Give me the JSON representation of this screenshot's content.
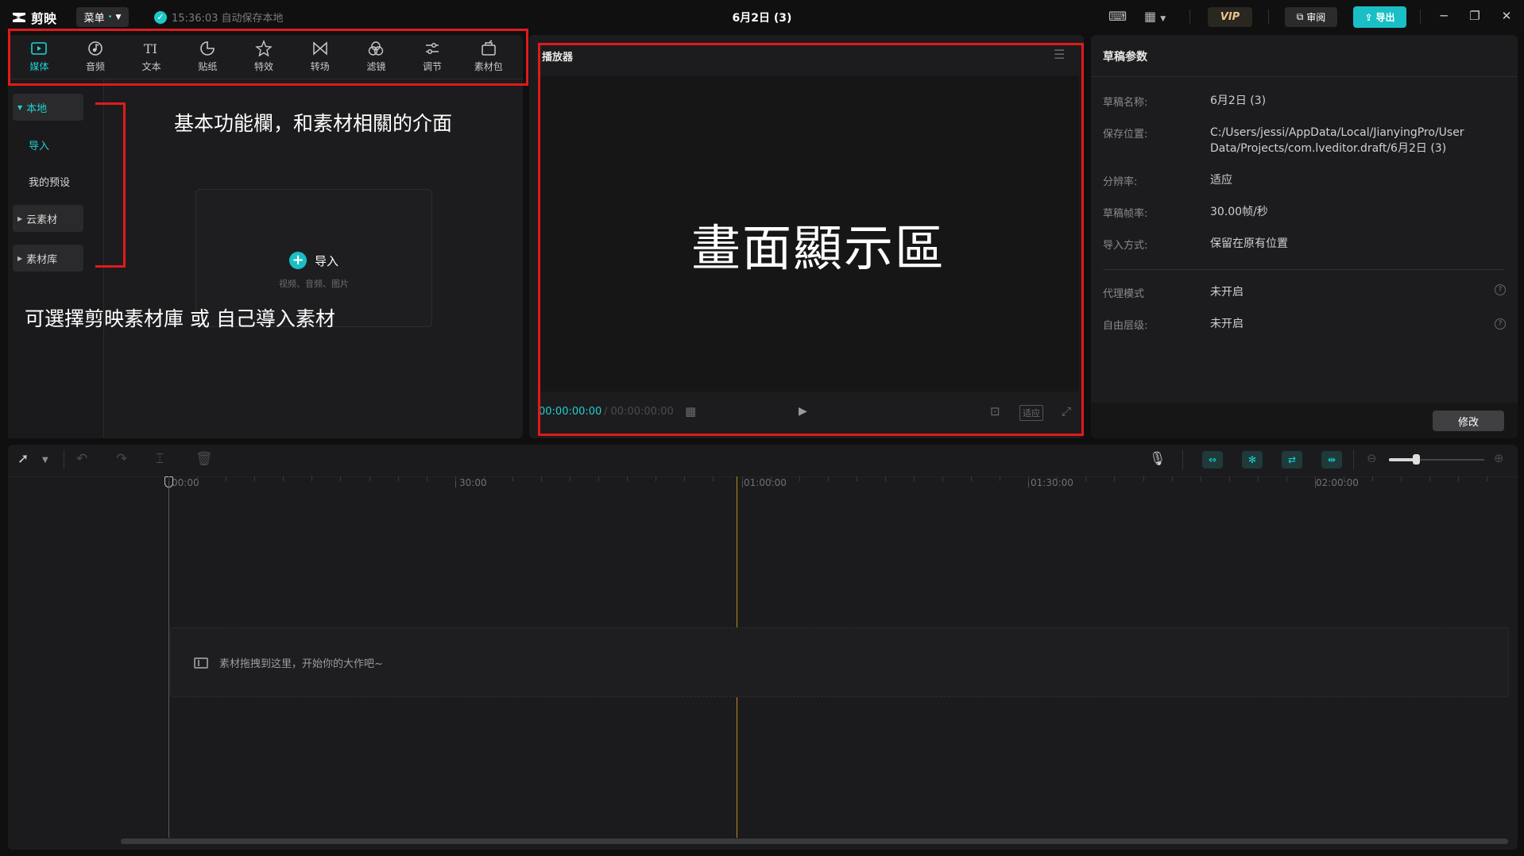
{
  "titlebar": {
    "app_name": "剪映",
    "menu_label": "菜单",
    "autosave": "15:36:03 自动保存本地",
    "doc_title": "6月2日 (3)",
    "vip_label": "VIP",
    "review_label": "审阅",
    "export_label": "导出"
  },
  "toolbar": {
    "tabs": [
      {
        "label": "媒体",
        "icon": "media-icon"
      },
      {
        "label": "音频",
        "icon": "audio-icon"
      },
      {
        "label": "文本",
        "icon": "text-icon"
      },
      {
        "label": "贴纸",
        "icon": "sticker-icon"
      },
      {
        "label": "特效",
        "icon": "effects-icon"
      },
      {
        "label": "转场",
        "icon": "transition-icon"
      },
      {
        "label": "滤镜",
        "icon": "filter-icon"
      },
      {
        "label": "调节",
        "icon": "adjust-icon"
      },
      {
        "label": "素材包",
        "icon": "material-pack-icon"
      }
    ]
  },
  "sidenav": {
    "local": "本地",
    "import": "导入",
    "presets": "我的预设",
    "cloud": "云素材",
    "library": "素材库"
  },
  "import_card": {
    "label": "导入",
    "hint": "视频、音频、图片"
  },
  "player": {
    "title": "播放器",
    "time_current": "00:00:00:00",
    "time_total": "/ 00:00:00:00",
    "fit_label": "适应"
  },
  "params": {
    "title": "草稿参数",
    "rows": [
      {
        "label": "草稿名称:",
        "value": "6月2日 (3)"
      },
      {
        "label": "保存位置:",
        "value": "C:/Users/jessi/AppData/Local/JianyingPro/User",
        "value2": "Data/Projects/com.lveditor.draft/6月2日 (3)"
      },
      {
        "label": "分辨率:",
        "value": "适应"
      },
      {
        "label": "草稿帧率:",
        "value": "30.00帧/秒"
      },
      {
        "label": "导入方式:",
        "value": "保留在原有位置"
      },
      {
        "label": "代理模式",
        "value": "未开启"
      },
      {
        "label": "自由层级:",
        "value": "未开启"
      }
    ],
    "modify_label": "修改"
  },
  "timeline": {
    "ticks": [
      "00:00",
      "30:00",
      "01:00:00",
      "01:30:00",
      "02:00:00"
    ],
    "drop_hint": "素材拖拽到这里，开始你的大作吧~"
  },
  "annotations": {
    "toolbar_note": "基本功能欄，和素材相關的介面",
    "library_note": "可選擇剪映素材庫 或 自己導入素材",
    "display_note": "畫面顯示區"
  },
  "colors": {
    "accent": "#1fd1d0",
    "annotation_red": "#e01a1a",
    "playhead": "#b88a2a"
  }
}
